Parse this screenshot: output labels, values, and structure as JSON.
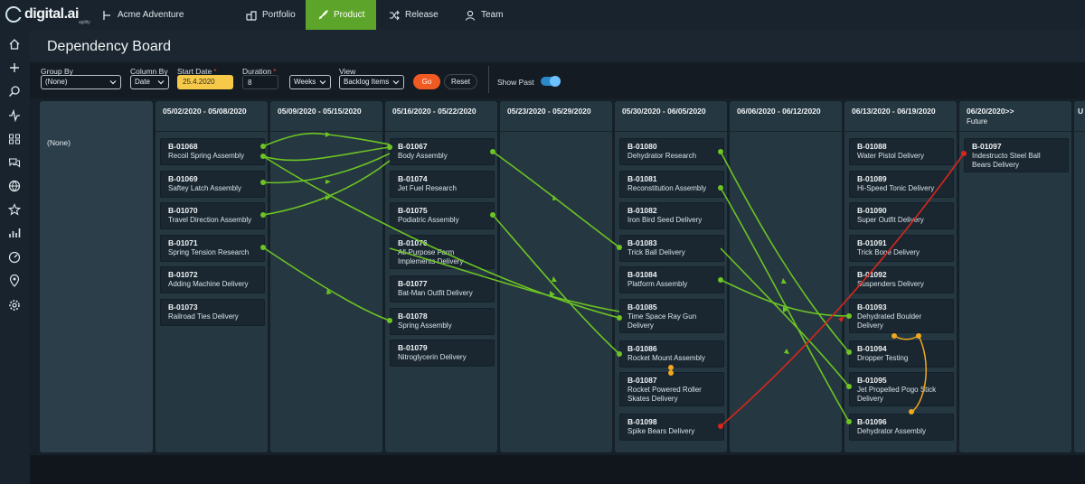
{
  "brand": {
    "name": "digital.ai",
    "sub": "agility"
  },
  "workspace": "Acme Adventure",
  "nav": {
    "portfolio": "Portfolio",
    "product": "Product",
    "release": "Release",
    "team": "Team"
  },
  "sidebar_icons": [
    "home-icon",
    "plus-icon",
    "search-icon",
    "activity-icon",
    "grid-icon",
    "chat-icon",
    "globe-icon",
    "star-icon",
    "chart-icon",
    "dashboard-icon",
    "location-icon",
    "gear-icon"
  ],
  "page_title": "Dependency Board",
  "filters": {
    "group_by_label": "Group By",
    "group_by_value": "(None)",
    "column_by_label": "Column By",
    "column_by_value": "Date",
    "start_date_label": "Start Date",
    "start_date_value": "25.4.2020",
    "duration_label": "Duration",
    "duration_value": "8",
    "duration_unit": "Weeks",
    "view_label": "View",
    "view_value": "Backlog Items",
    "go": "Go",
    "reset": "Reset",
    "show_past": "Show Past"
  },
  "row_label": "(None)",
  "columns": [
    {
      "title": "05/02/2020 - 05/08/2020",
      "sub": ""
    },
    {
      "title": "05/09/2020 - 05/15/2020",
      "sub": ""
    },
    {
      "title": "05/16/2020 - 05/22/2020",
      "sub": ""
    },
    {
      "title": "05/23/2020 - 05/29/2020",
      "sub": ""
    },
    {
      "title": "05/30/2020 - 06/05/2020",
      "sub": ""
    },
    {
      "title": "06/06/2020 - 06/12/2020",
      "sub": ""
    },
    {
      "title": "06/13/2020 - 06/19/2020",
      "sub": ""
    },
    {
      "title": "06/20/2020>>",
      "sub": "Future"
    },
    {
      "title": "U",
      "sub": ""
    }
  ],
  "cards": {
    "c0": [
      {
        "id": "B-01068",
        "name": "Recoil Spring Assembly"
      },
      {
        "id": "B-01069",
        "name": "Saftey Latch Assembly"
      },
      {
        "id": "B-01070",
        "name": "Travel Direction Assembly"
      },
      {
        "id": "B-01071",
        "name": "Spring Tension Research"
      },
      {
        "id": "B-01072",
        "name": "Adding Machine Delivery"
      },
      {
        "id": "B-01073",
        "name": "Railroad Ties Delivery"
      }
    ],
    "c2": [
      {
        "id": "B-01067",
        "name": "Body Assembly"
      },
      {
        "id": "B-01074",
        "name": "Jet Fuel Research"
      },
      {
        "id": "B-01075",
        "name": "Podiatric Assembly"
      },
      {
        "id": "B-01076",
        "name": "All-Purpose Farm Implements Delivery"
      },
      {
        "id": "B-01077",
        "name": "Bat-Man Outfit Delivery"
      },
      {
        "id": "B-01078",
        "name": "Spring Assembly"
      },
      {
        "id": "B-01079",
        "name": "Nitroglycerin Delivery"
      }
    ],
    "c4": [
      {
        "id": "B-01080",
        "name": "Dehydrator Research"
      },
      {
        "id": "B-01081",
        "name": "Reconstitution Assembly"
      },
      {
        "id": "B-01082",
        "name": "Iron Bird Seed Delivery"
      },
      {
        "id": "B-01083",
        "name": "Trick Ball Delivery"
      },
      {
        "id": "B-01084",
        "name": "Platform Assembly"
      },
      {
        "id": "B-01085",
        "name": "Time Space Ray Gun Delivery"
      },
      {
        "id": "B-01086",
        "name": "Rocket Mount Assembly"
      },
      {
        "id": "B-01087",
        "name": "Rocket Powered Roller Skates Delivery"
      },
      {
        "id": "B-01098",
        "name": "Spike Bears Delivery"
      }
    ],
    "c6": [
      {
        "id": "B-01088",
        "name": "Water Pistol Delivery"
      },
      {
        "id": "B-01089",
        "name": "Hi-Speed Tonic Delivery"
      },
      {
        "id": "B-01090",
        "name": "Super Outfit Delivery"
      },
      {
        "id": "B-01091",
        "name": "Trick Bone Delivery"
      },
      {
        "id": "B-01092",
        "name": "Suspenders Delivery"
      },
      {
        "id": "B-01093",
        "name": "Dehydrated Boulder Delivery"
      },
      {
        "id": "B-01094",
        "name": "Dropper Testing"
      },
      {
        "id": "B-01095",
        "name": "Jet Propelled Pogo Stick Delivery"
      },
      {
        "id": "B-01096",
        "name": "Dehydrator Assembly"
      }
    ],
    "c7": [
      {
        "id": "B-01097",
        "name": "Indestructo Steel Ball Bears Delivery"
      }
    ]
  },
  "colors": {
    "ok_dependency": "#6cc424",
    "broken_dependency": "#d8261c",
    "same_column_dependency": "#f0a81c",
    "active_nav": "#5da52a",
    "go_button": "#f05a22"
  }
}
